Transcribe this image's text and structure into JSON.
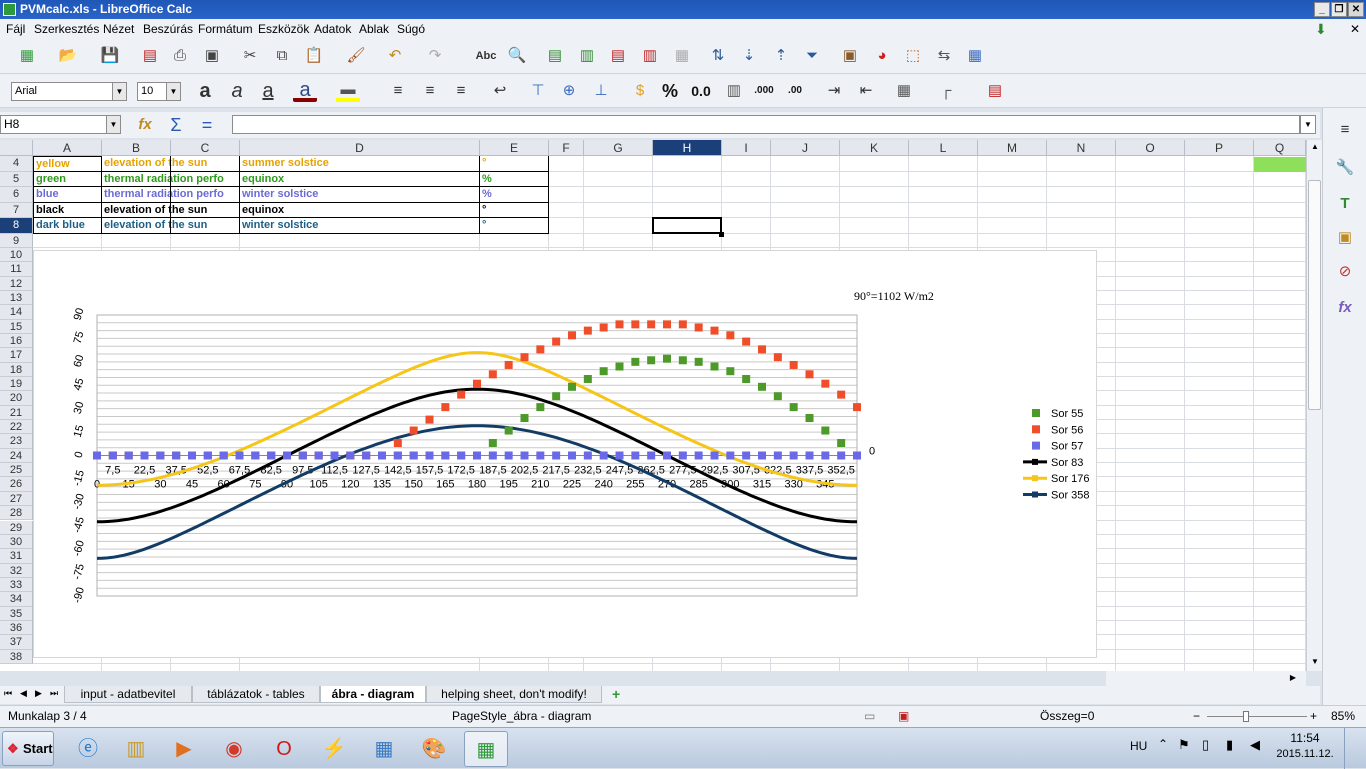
{
  "window": {
    "title": "PVMcalc.xls - LibreOffice Calc"
  },
  "menu": [
    "Fájl",
    "Szerkesztés",
    "Nézet",
    "Beszúrás",
    "Formátum",
    "Eszközök",
    "Adatok",
    "Ablak",
    "Súgó"
  ],
  "font": {
    "name": "Arial",
    "size": "10"
  },
  "toolbar_icons": {
    "percent": "%",
    "number": "0.0",
    "decimals_add": ".000",
    "decimals_remove": ".00"
  },
  "name_box": "H8",
  "formula": "",
  "columns": [
    "A",
    "B",
    "C",
    "D",
    "E",
    "F",
    "G",
    "H",
    "I",
    "J",
    "K",
    "L",
    "M",
    "N",
    "O",
    "P",
    "Q"
  ],
  "rows": [
    "4",
    "5",
    "6",
    "7",
    "8",
    "9",
    "10",
    "11",
    "12",
    "13",
    "14",
    "15",
    "16",
    "17",
    "18",
    "19",
    "20",
    "21",
    "22",
    "23",
    "24",
    "25",
    "26",
    "27",
    "28",
    "29",
    "30",
    "31",
    "32",
    "33",
    "34",
    "35",
    "36",
    "37",
    "38"
  ],
  "legend_table": [
    {
      "color": "yellow",
      "quantity": "elevation of the sun",
      "day": "summer solstice",
      "unit": "°",
      "hex": "#e6a300"
    },
    {
      "color": "green",
      "quantity": "thermal radiation perfo",
      "day": "equinox",
      "unit": "%",
      "hex": "#2f9a1e"
    },
    {
      "color": "blue",
      "quantity": "thermal radiation perfo",
      "day": "winter solstice",
      "unit": "%",
      "hex": "#6b6bd6"
    },
    {
      "color": "black",
      "quantity": "elevation of the sun",
      "day": "equinox",
      "unit": "°",
      "hex": "#000000"
    },
    {
      "color": "dark blue",
      "quantity": "elevation of the sun",
      "day": "winter solstice",
      "unit": "°",
      "hex": "#1d5f86"
    }
  ],
  "chart_data": {
    "type": "line",
    "annotation": "90°=1102 W/m2",
    "x_top_ticks": [
      "7,5",
      "22,5",
      "37,5",
      "52,5",
      "67,5",
      "82,5",
      "97,5",
      "112,5",
      "127,5",
      "142,5",
      "157,5",
      "172,5",
      "187,5",
      "202,5",
      "217,5",
      "232,5",
      "247,5",
      "262,5",
      "277,5",
      "292,5",
      "307,5",
      "322,5",
      "337,5",
      "352,5"
    ],
    "x_bottom_ticks": [
      "0",
      "15",
      "30",
      "45",
      "60",
      "75",
      "90",
      "105",
      "120",
      "135",
      "150",
      "165",
      "180",
      "195",
      "210",
      "225",
      "240",
      "255",
      "270",
      "285",
      "300",
      "315",
      "330",
      "345"
    ],
    "y_ticks": [
      "90",
      "75",
      "60",
      "45",
      "30",
      "15",
      "0",
      "-15",
      "-30",
      "-45",
      "-60",
      "-75",
      "-90"
    ],
    "ylim": [
      -90,
      90
    ],
    "xlim": [
      0,
      360
    ],
    "right_label": "0",
    "x_step": 7.5,
    "series": [
      {
        "name": "Sor 55",
        "kind": "points",
        "color": "#4d9a2a",
        "values": [
          0,
          0,
          0,
          0,
          0,
          0,
          0,
          0,
          0,
          0,
          0,
          0,
          0,
          0,
          0,
          0,
          0,
          0,
          0,
          0,
          0,
          0,
          0,
          0,
          0,
          8,
          16,
          24,
          31,
          38,
          44,
          49,
          54,
          57,
          60,
          61,
          62,
          61,
          60,
          57,
          54,
          49,
          44,
          38,
          31,
          24,
          16,
          8,
          0,
          0,
          0,
          0,
          0,
          0,
          0,
          0,
          0,
          0,
          0,
          0,
          0,
          0,
          0,
          0,
          0,
          0,
          0,
          0,
          0,
          0,
          0,
          0,
          0
        ]
      },
      {
        "name": "Sor 56",
        "kind": "points",
        "color": "#f04e2a",
        "values": [
          0,
          0,
          0,
          0,
          0,
          0,
          0,
          0,
          0,
          0,
          0,
          0,
          0,
          0,
          0,
          0,
          0,
          0,
          0,
          8,
          16,
          23,
          31,
          39,
          46,
          52,
          58,
          63,
          68,
          73,
          77,
          80,
          82,
          84,
          84,
          84,
          84,
          84,
          82,
          80,
          77,
          73,
          68,
          63,
          58,
          52,
          46,
          39,
          31,
          23,
          16,
          8,
          0,
          0,
          0,
          0,
          0,
          0,
          0,
          0,
          0,
          0,
          0,
          0,
          0,
          0,
          0,
          0,
          0,
          0,
          0,
          0,
          0
        ]
      },
      {
        "name": "Sor 57",
        "kind": "points",
        "color": "#6a6ae8",
        "values": [
          0,
          0,
          0,
          0,
          0,
          0,
          0,
          0,
          0,
          0,
          0,
          0,
          0,
          0,
          0,
          0,
          0,
          0,
          0,
          0,
          0,
          0,
          0,
          0,
          0,
          0,
          0,
          0,
          0,
          0,
          0,
          0,
          0,
          0,
          0,
          0,
          0,
          0,
          0,
          0,
          0,
          0,
          0,
          0,
          0,
          0,
          0,
          0,
          0,
          0,
          0,
          0,
          0,
          0,
          0,
          0,
          0,
          0,
          0,
          0,
          0,
          0,
          0,
          0,
          0,
          0,
          0,
          0,
          0,
          0,
          0,
          0,
          0
        ]
      },
      {
        "name": "Sor 83",
        "kind": "line",
        "color": "#000000",
        "amplitude": 42,
        "inclination": 42
      },
      {
        "name": "Sor 176",
        "kind": "line",
        "color": "#f5c518",
        "amplitude": 42,
        "inclination": 24
      },
      {
        "name": "Sor 358",
        "kind": "line",
        "color": "#123c66",
        "amplitude": 42,
        "inclination": -21
      }
    ]
  },
  "sheet_tabs": [
    "input - adatbevitel",
    "táblázatok - tables",
    "ábra - diagram",
    "helping sheet, don't modify!"
  ],
  "active_tab": "ábra - diagram",
  "status": {
    "sheet": "Munkalap 3 / 4",
    "page_style": "PageStyle_ábra - diagram",
    "sum": "Összeg=0",
    "zoom": "85%"
  },
  "taskbar": {
    "start": "Start",
    "lang": "HU",
    "time": "11:54",
    "date": "2015.11.12."
  }
}
